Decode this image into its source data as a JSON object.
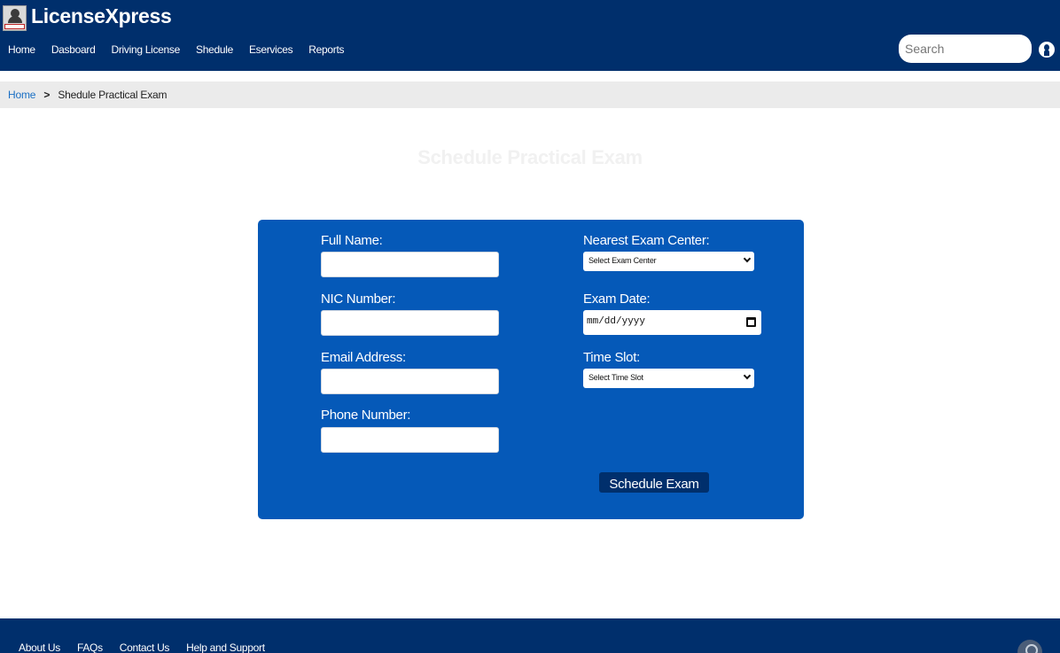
{
  "header": {
    "brand": "LicenseXpress",
    "logo_icon": "license-logo-icon",
    "nav": [
      "Home",
      "Dasboard",
      "Driving License",
      "Shedule",
      "Eservices",
      "Reports"
    ],
    "search_placeholder": "Search",
    "user_icon": "user-icon"
  },
  "breadcrumb": {
    "home": "Home",
    "separator": ">",
    "current": "Shedule Practical Exam"
  },
  "page": {
    "title": "Schedule Practical Exam"
  },
  "form": {
    "full_name_label": "Full Name:",
    "full_name_value": "",
    "nic_label": "NIC Number:",
    "nic_value": "",
    "email_label": "Email Address:",
    "email_value": "",
    "phone_label": "Phone Number:",
    "phone_value": "",
    "exam_center_label": "Nearest Exam Center:",
    "exam_center_selected": "Select Exam Center",
    "exam_date_label": "Exam Date:",
    "exam_date_placeholder": "mm/dd/yyyy",
    "time_slot_label": "Time Slot:",
    "time_slot_selected": "Select Time Slot",
    "submit_label": "Schedule Exam"
  },
  "footer": {
    "links": [
      "About Us",
      "FAQs",
      "Contact Us",
      "Help and Support"
    ]
  },
  "colors": {
    "header_bg": "#002f6c",
    "panel_bg": "#0559b8",
    "breadcrumb_bg": "#ebebeb",
    "link": "#1a6fc4",
    "title": "#f1f1f1"
  }
}
